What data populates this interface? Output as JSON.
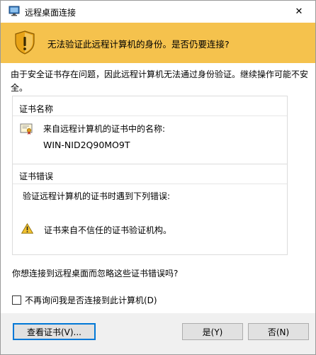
{
  "window": {
    "title": "远程桌面连接",
    "close_glyph": "✕"
  },
  "banner": {
    "message": "无法验证此远程计算机的身份。是否仍要连接?"
  },
  "intro": {
    "text": "由于安全证书存在问题，因此远程计算机无法通过身份验证。继续操作可能不安全。"
  },
  "certificate": {
    "group_title": "证书名称",
    "label": "来自远程计算机的证书中的名称:",
    "name": "WIN-NID2Q90MO9T"
  },
  "errors": {
    "group_title": "证书错误",
    "label": "验证远程计算机的证书时遇到下列错误:",
    "items": [
      "证书来自不信任的证书验证机构。"
    ]
  },
  "question": "你想连接到远程桌面而忽略这些证书错误吗?",
  "dont_ask": {
    "label": "不再询问我是否连接到此计算机(D)",
    "checked": false
  },
  "buttons": {
    "view_cert": "查看证书(V)...",
    "yes": "是(Y)",
    "no": "否(N)"
  },
  "colors": {
    "banner": "#f5c24d",
    "focus_border": "#0078d7"
  }
}
